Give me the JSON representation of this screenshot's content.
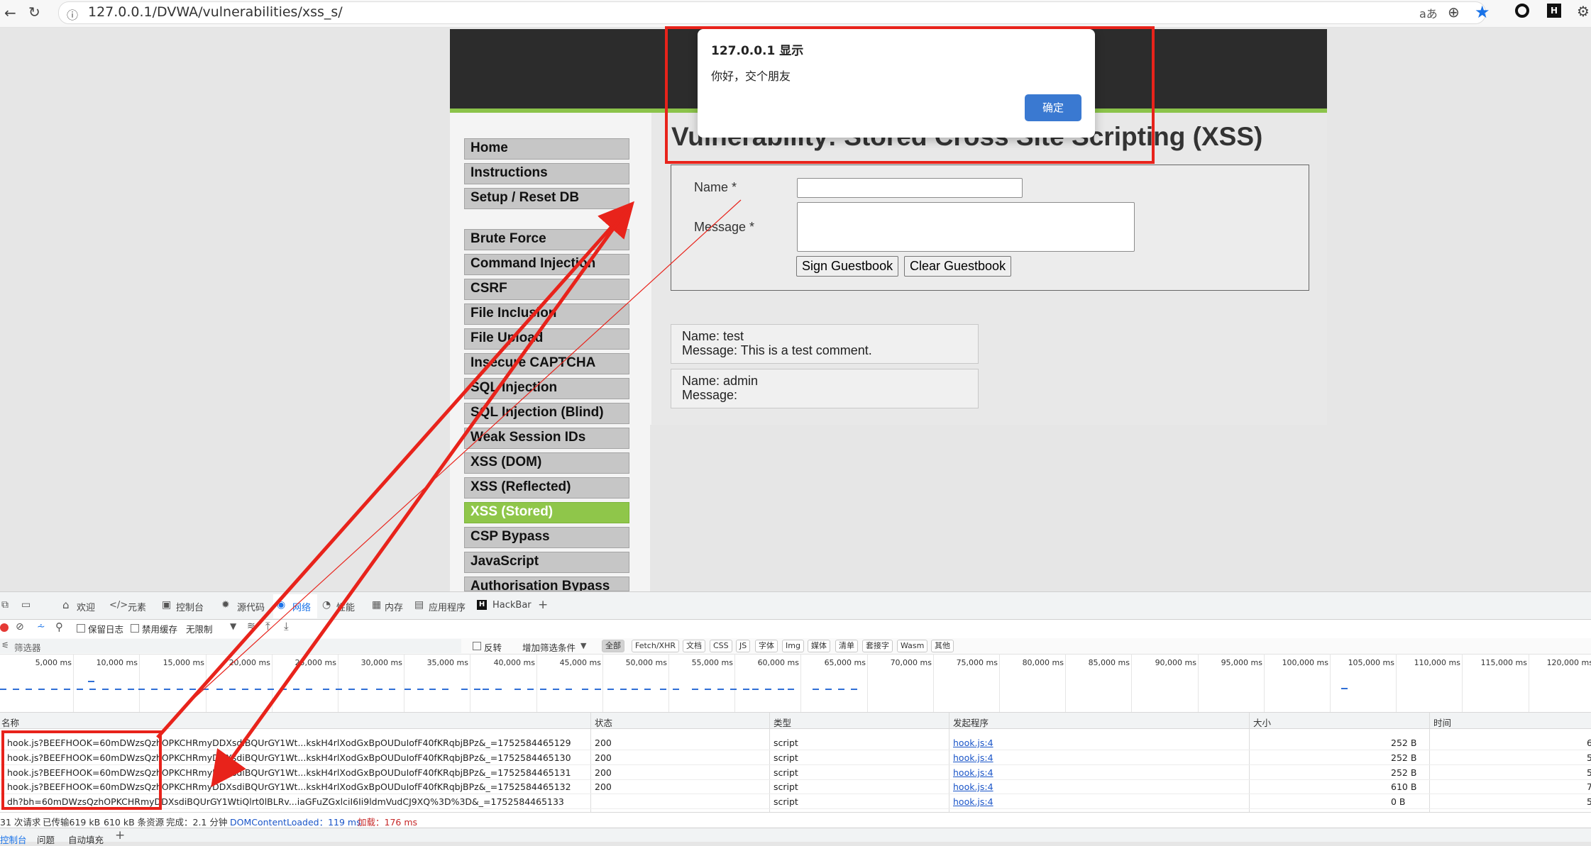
{
  "browser": {
    "url": "127.0.0.1/DVWA/vulnerabilities/xss_s/",
    "icons": [
      "back-icon",
      "reload-icon",
      "info-icon",
      "read-aloud-icon",
      "zoom-icon",
      "bookmark-star-icon",
      "extension-icon",
      "hackbar-icon",
      "settings-icon"
    ]
  },
  "alert": {
    "title": "127.0.0.1 显示",
    "message": "你好，交个朋友",
    "ok_label": "确定"
  },
  "dvwa": {
    "menu_group1": [
      "Home",
      "Instructions",
      "Setup / Reset DB"
    ],
    "menu_group2": [
      "Brute Force",
      "Command Injection",
      "CSRF",
      "File Inclusion",
      "File Upload",
      "Insecure CAPTCHA",
      "SQL Injection",
      "SQL Injection (Blind)",
      "Weak Session IDs",
      "XSS (DOM)",
      "XSS (Reflected)",
      "XSS (Stored)",
      "CSP Bypass",
      "JavaScript",
      "Authorisation Bypass"
    ],
    "active_menu": "XSS (Stored)",
    "title": "Vulnerability: Stored Cross Site Scripting (XSS)",
    "form": {
      "name_label": "Name *",
      "message_label": "Message *",
      "sign_button": "Sign Guestbook",
      "clear_button": "Clear Guestbook"
    },
    "comments": [
      {
        "name_line": "Name: test",
        "message_line": "Message: This is a test comment."
      },
      {
        "name_line": "Name: admin",
        "message_line": "Message:"
      }
    ]
  },
  "devtools": {
    "tabs": [
      "欢迎",
      "元素",
      "控制台",
      "源代码",
      "网络",
      "性能",
      "内存",
      "应用程序",
      "HackBar"
    ],
    "active_tab": "网络",
    "toolbar": {
      "preserve_log": "保留日志",
      "disable_cache": "禁用缓存",
      "throttle": "无限制"
    },
    "filter": {
      "placeholder": "筛选器",
      "invert": "反转",
      "more_filters": "增加筛选条件",
      "chips": [
        "全部",
        "Fetch/XHR",
        "文档",
        "CSS",
        "JS",
        "字体",
        "Img",
        "媒体",
        "清单",
        "套接字",
        "Wasm",
        "其他"
      ],
      "active_chip": "全部"
    },
    "timeline_ticks": [
      "5,000 ms",
      "10,000 ms",
      "15,000 ms",
      "20,000 ms",
      "25,000 ms",
      "30,000 ms",
      "35,000 ms",
      "40,000 ms",
      "45,000 ms",
      "50,000 ms",
      "55,000 ms",
      "60,000 ms",
      "65,000 ms",
      "70,000 ms",
      "75,000 ms",
      "80,000 ms",
      "85,000 ms",
      "90,000 ms",
      "95,000 ms",
      "100,000 ms",
      "105,000 ms",
      "110,000 ms",
      "115,000 ms",
      "120,000 ms"
    ],
    "columns": [
      "名称",
      "状态",
      "类型",
      "发起程序",
      "大小",
      "时间"
    ],
    "rows": [
      {
        "name": "hook.js?BEEFHOOK=60mDWzsQzhOPKCHRmyDDXsdiBQUrGY1Wt...kskH4rlXodGxBpOUDuIofF40fKRqbjBPz&_=1752584465129",
        "status": "200",
        "type": "script",
        "initiator": "hook.js:4",
        "size": "252 B",
        "time": "6"
      },
      {
        "name": "hook.js?BEEFHOOK=60mDWzsQzhOPKCHRmyDDXsdiBQUrGY1Wt...kskH4rlXodGxBpOUDuIofF40fKRqbjBPz&_=1752584465130",
        "status": "200",
        "type": "script",
        "initiator": "hook.js:4",
        "size": "252 B",
        "time": "5"
      },
      {
        "name": "hook.js?BEEFHOOK=60mDWzsQzhOPKCHRmyDDXsdiBQUrGY1Wt...kskH4rlXodGxBpOUDuIofF40fKRqbjBPz&_=1752584465131",
        "status": "200",
        "type": "script",
        "initiator": "hook.js:4",
        "size": "252 B",
        "time": "5"
      },
      {
        "name": "hook.js?BEEFHOOK=60mDWzsQzhOPKCHRmyDDXsdiBQUrGY1Wt...kskH4rlXodGxBpOUDuIofF40fKRqbjBPz&_=1752584465132",
        "status": "200",
        "type": "script",
        "initiator": "hook.js:4",
        "size": "610 B",
        "time": "7"
      },
      {
        "name": "dh?bh=60mDWzsQzhOPKCHRmyDDXsdiBQUrGY1WtiQlrt0lBLRv...iaGFuZGxlciI6Ii9ldmVudCJ9XQ%3D%3D&_=1752584465133",
        "status": "",
        "type": "script",
        "initiator": "hook.js:4",
        "size": "0 B",
        "time": "5"
      }
    ],
    "status_bar": {
      "requests": "31 次请求",
      "transferred": "已传输619 kB",
      "resources": "610 kB 条资源",
      "finish": "完成：2.1 分钟",
      "dcl": "DOMContentLoaded：119 ms",
      "load": "加载：176 ms"
    },
    "bottom_tabs": [
      "控制台",
      "问题",
      "自动填充"
    ]
  }
}
